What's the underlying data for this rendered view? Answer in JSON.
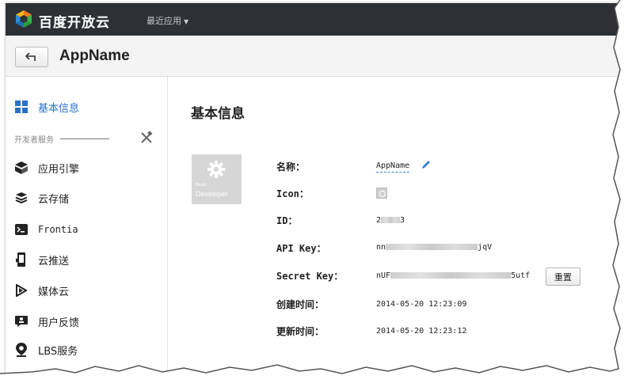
{
  "brand": {
    "name": "百度开放云",
    "recent_apps_label": "最近应用"
  },
  "titlebar": {
    "app_name": "AppName"
  },
  "sidebar": {
    "basic_info": "基本信息",
    "section_label": "开发者服务",
    "items": [
      {
        "label": "应用引擎",
        "icon": "app-engine-icon"
      },
      {
        "label": "云存储",
        "icon": "cloud-storage-icon"
      },
      {
        "label": "Frontia",
        "icon": "frontia-icon"
      },
      {
        "label": "云推送",
        "icon": "cloud-push-icon"
      },
      {
        "label": "媒体云",
        "icon": "media-cloud-icon"
      },
      {
        "label": "用户反馈",
        "icon": "feedback-icon"
      },
      {
        "label": "LBS服务",
        "icon": "location-pin-icon"
      },
      {
        "label": "...",
        "icon": "more-icon"
      }
    ]
  },
  "main": {
    "title": "基本信息",
    "logo": {
      "brand": "Baidu",
      "text": "Developer"
    },
    "fields": {
      "name_label": "名称：",
      "name_value": "AppName",
      "icon_label": "Icon：",
      "id_label": "ID：",
      "id_prefix": "2",
      "id_suffix": "3",
      "api_key_label": "API Key：",
      "api_key_prefix": "nn",
      "api_key_suffix": "jqV",
      "secret_key_label": "Secret Key：",
      "secret_key_prefix": "nUF",
      "secret_key_suffix": "5utf",
      "reset_label": "重置",
      "created_label": "创建时间：",
      "created_value": "2014-05-20 12:23:09",
      "updated_label": "更新时间：",
      "updated_value": "2014-05-20 12:23:12"
    }
  },
  "colors": {
    "topbar": "#2d3136",
    "accent": "#2a6fcb",
    "logo_orange": "#f07b1d",
    "logo_blue": "#2e8fd8",
    "logo_green": "#39b54a"
  }
}
